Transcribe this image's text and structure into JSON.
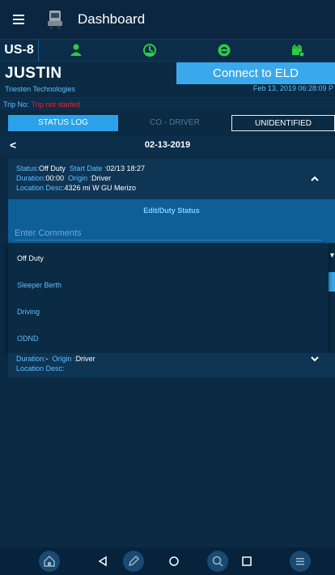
{
  "app": {
    "title": "Dashboard"
  },
  "status_bar": {
    "rule_set": "US-8"
  },
  "driver": {
    "name": "JUSTIN",
    "company": "Triesten Technologies",
    "connect_label": "Connect to ELD",
    "datetime": "Feb 13, 2019 06:28:09 P"
  },
  "trip": {
    "label": "Trip No:",
    "value": "Trip not started"
  },
  "tabs": [
    {
      "label": "STATUS LOG",
      "active": true
    },
    {
      "label": "CO - DRIVER",
      "active": false
    },
    {
      "label": "UNIDENTIFIED",
      "active": false
    }
  ],
  "log": {
    "date": "02-13-2019",
    "status_key": "Status:",
    "status_value": "Off Duty",
    "start_key": "Start Date :",
    "start_value": "02/13 18:27",
    "duration_key": "Duration:",
    "duration_value": "00:00",
    "origin_key": "Origin :",
    "origin_value": "Driver",
    "location_key": "Location Desc:",
    "location_value": "4326 mi W GU Merizo"
  },
  "edit": {
    "title": "Edit/Duty Status",
    "comment_placeholder": "Enter Comments",
    "options": [
      "Off Duty",
      "Sleeper Berth",
      "Driving",
      "ODND"
    ],
    "selected": "Off Duty"
  },
  "log2": {
    "duration_key": "Duration:",
    "duration_value": "-",
    "origin_key": "Origin :",
    "origin_value": "Driver",
    "location_key": "Location Desc:",
    "location_value": ""
  },
  "colors": {
    "background": "#0b2a43",
    "accent": "#3aa9ec",
    "label_blue": "#5fc0ff",
    "status_green": "#2ecc40",
    "trip_red": "#e8262c"
  },
  "icons": [
    "menu-icon",
    "truck-icon",
    "driver-icon",
    "on-duty-icon",
    "steering-wheel-icon",
    "calendar-icon",
    "back-arrow-icon",
    "chevron-up-icon",
    "chevron-down-icon",
    "home-icon",
    "pencil-icon",
    "search-icon",
    "list-icon"
  ]
}
